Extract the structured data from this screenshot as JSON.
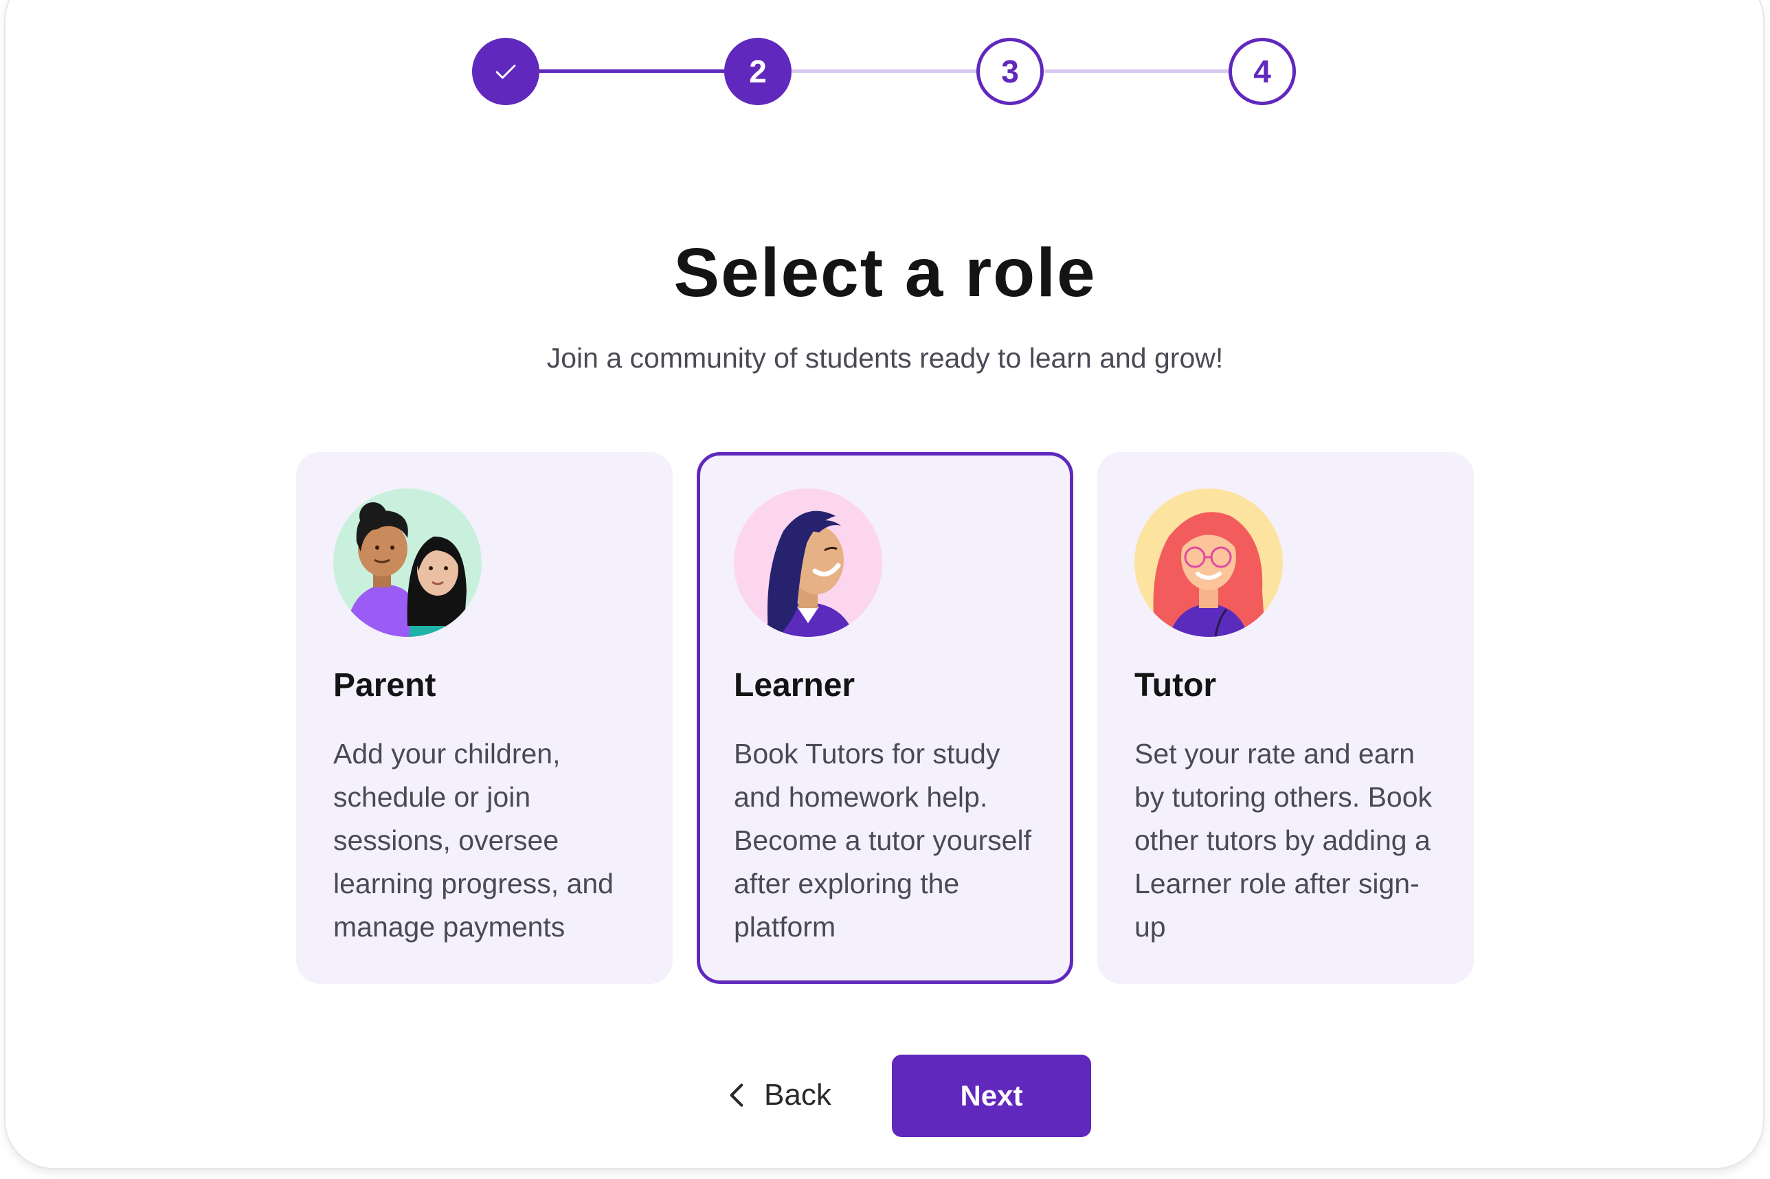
{
  "stepper": {
    "steps": [
      {
        "label": "",
        "state": "completed",
        "icon": "check-icon"
      },
      {
        "label": "2",
        "state": "current"
      },
      {
        "label": "3",
        "state": "upcoming"
      },
      {
        "label": "4",
        "state": "upcoming"
      }
    ]
  },
  "header": {
    "title": "Select a role",
    "subtitle": "Join a community of students ready to learn and grow!"
  },
  "roles": [
    {
      "title": "Parent",
      "description": "Add your children, schedule or join sessions, oversee learning progress, and manage payments",
      "avatar": "parent-and-child-avatar",
      "selected": false
    },
    {
      "title": "Learner",
      "description": "Book Tutors for study and homework help. Become a tutor yourself after exploring the platform",
      "avatar": "learner-avatar",
      "selected": true
    },
    {
      "title": "Tutor",
      "description": "Set your rate and earn by tutoring others. Book other tutors by adding a Learner role after sign-up",
      "avatar": "tutor-avatar",
      "selected": false
    }
  ],
  "actions": {
    "back_label": "Back",
    "next_label": "Next"
  },
  "colors": {
    "accent": "#6028bd",
    "accent_light": "#d6c8f0",
    "card_bg": "#f4f1fd",
    "text_dark": "#141414",
    "text_muted": "#4a4a55"
  }
}
